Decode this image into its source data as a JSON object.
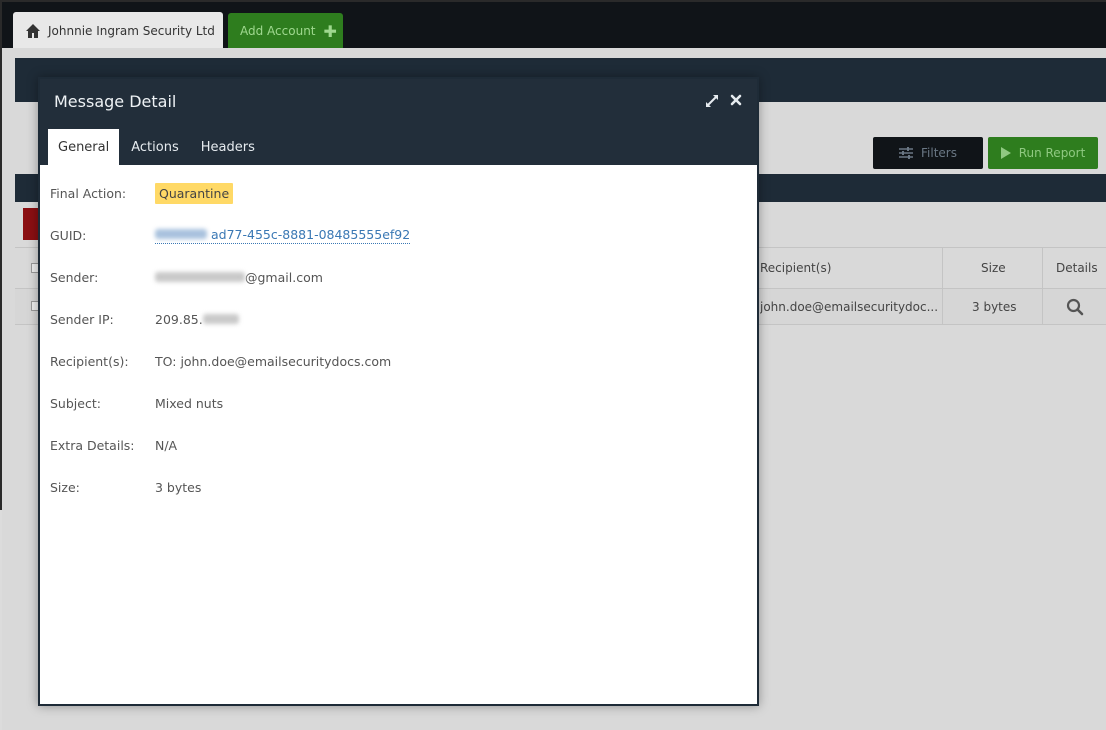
{
  "topbar": {
    "account_tab_label": "Johnnie Ingram Security Ltd",
    "add_account_label": "Add Account"
  },
  "toolbar": {
    "filters_label": "Filters",
    "run_report_label": "Run Report"
  },
  "table": {
    "columns": [
      "Recipient(s)",
      "Size",
      "Details"
    ],
    "rows": [
      {
        "recipients": "john.doe@emailsecuritydoc...",
        "size": "3 bytes"
      }
    ]
  },
  "modal": {
    "title": "Message Detail",
    "tabs": [
      "General",
      "Actions",
      "Headers"
    ],
    "active_tab": "General",
    "fields": {
      "final_action": {
        "label": "Final Action:",
        "value": "Quarantine"
      },
      "guid": {
        "label": "GUID:",
        "value_visible": "ad77-455c-8881-08485555ef92"
      },
      "sender": {
        "label": "Sender:",
        "value_visible": "@gmail.com"
      },
      "sender_ip": {
        "label": "Sender IP:",
        "value_visible": "209.85."
      },
      "recipients": {
        "label": "Recipient(s):",
        "value": "TO: john.doe@emailsecuritydocs.com"
      },
      "subject": {
        "label": "Subject:",
        "value": "Mixed nuts"
      },
      "extra_details": {
        "label": "Extra Details:",
        "value": "N/A"
      },
      "size": {
        "label": "Size:",
        "value": "3 bytes"
      }
    }
  },
  "colors": {
    "header_dark": "#222e3a",
    "badge_yellow": "#ffd966",
    "link_blue": "#3a78b4",
    "green": "#2e7d1e"
  }
}
